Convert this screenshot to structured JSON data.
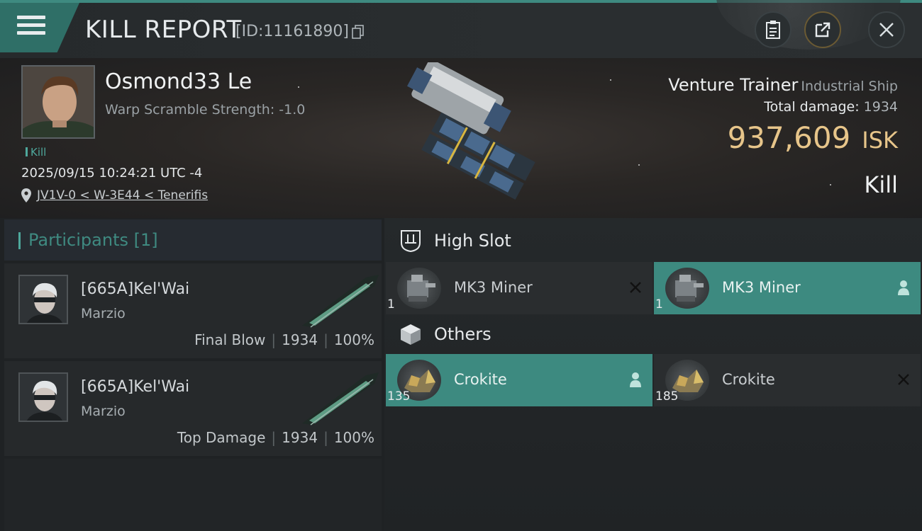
{
  "header": {
    "title": "KILL REPORT",
    "report_id": "[ID:11161890]"
  },
  "victim": {
    "name": "Osmond33 Le",
    "warp_scramble": "Warp Scramble Strength: -1.0",
    "tag": "Kill",
    "datetime": "2025/09/15 10:24:21 UTC -4",
    "location": "JV1V-0 < W-3E44 < Tenerifis"
  },
  "ship": {
    "name": "Venture Trainer",
    "class": "Industrial Ship",
    "total_damage_label": "Total damage:",
    "total_damage": "1934",
    "isk_value": "937,609",
    "isk_unit": "ISK",
    "result": "Kill"
  },
  "participants": {
    "header": "Participants [1]",
    "items": [
      {
        "name": "[665A]Kel'Wai",
        "ship": "Marzio",
        "role": "Final Blow",
        "damage": "1934",
        "percent": "100%"
      },
      {
        "name": "[665A]Kel'Wai",
        "ship": "Marzio",
        "role": "Top Damage",
        "damage": "1934",
        "percent": "100%"
      }
    ]
  },
  "fitting": {
    "high_slot_label": "High Slot",
    "others_label": "Others",
    "high_slot": [
      {
        "name": "MK3 Miner",
        "qty": "1",
        "status": "destroyed",
        "status_icon": "x-icon"
      },
      {
        "name": "MK3 Miner",
        "qty": "1",
        "status": "dropped",
        "status_icon": "person-icon"
      }
    ],
    "others": [
      {
        "name": "Crokite",
        "qty": "135",
        "status": "dropped",
        "status_icon": "person-icon"
      },
      {
        "name": "Crokite",
        "qty": "185",
        "status": "destroyed",
        "status_icon": "x-icon"
      }
    ]
  },
  "colors": {
    "accent": "#3e8a80",
    "isk": "#e7c58a",
    "active_slot": "#3d8a80"
  }
}
